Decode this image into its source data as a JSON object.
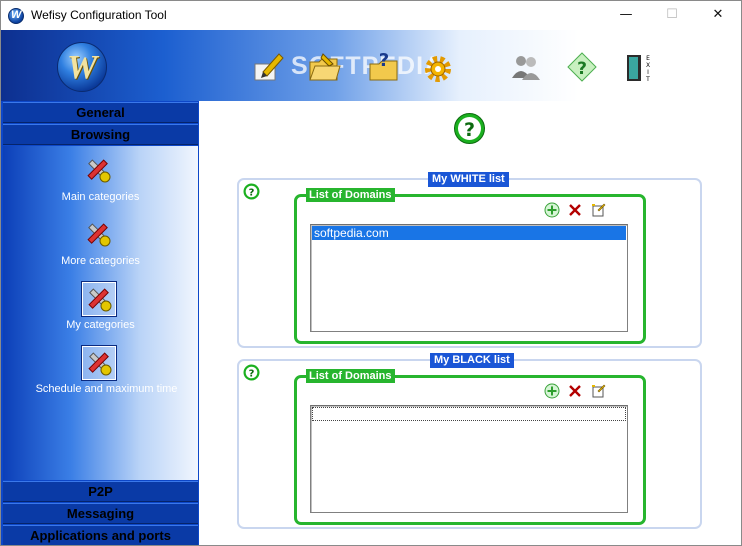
{
  "window": {
    "title": "Wefisy Configuration Tool",
    "icon": "wefisy-app-icon",
    "minimize_glyph": "—",
    "maximize_glyph": "☐",
    "close_glyph": "✕"
  },
  "banner": {
    "logo_letter": "W",
    "watermark": "SOFTPEDIA",
    "toolbar": [
      {
        "name": "edit-pencil-icon"
      },
      {
        "name": "open-folder-icon"
      },
      {
        "name": "help-folder-icon"
      },
      {
        "name": "settings-gear-icon"
      },
      {
        "name": "users-icon"
      },
      {
        "name": "help-icon"
      },
      {
        "name": "exit-door-icon",
        "text": "EXIT"
      }
    ]
  },
  "sidebar": {
    "sections": [
      {
        "id": "general",
        "label": "General"
      },
      {
        "id": "browsing",
        "label": "Browsing"
      },
      {
        "id": "p2p",
        "label": "P2P"
      },
      {
        "id": "messaging",
        "label": "Messaging"
      },
      {
        "id": "apps",
        "label": "Applications and ports"
      }
    ],
    "browsing_items": [
      {
        "label": "Main categories",
        "selected": false
      },
      {
        "label": "More categories",
        "selected": false
      },
      {
        "label": "My categories",
        "selected": true
      },
      {
        "label": "Schedule and maximum time",
        "selected": true
      }
    ]
  },
  "main": {
    "white_list": {
      "title": "My WHITE list",
      "domains_title": "List of Domains",
      "items": [
        "softpedia.com"
      ]
    },
    "black_list": {
      "title": "My BLACK list",
      "domains_title": "List of Domains",
      "items": []
    }
  },
  "colors": {
    "nav_blue": "#0d47c8",
    "group_title_blue": "#1a56d6",
    "green": "#27b52e",
    "selection_blue": "#1975e6"
  }
}
